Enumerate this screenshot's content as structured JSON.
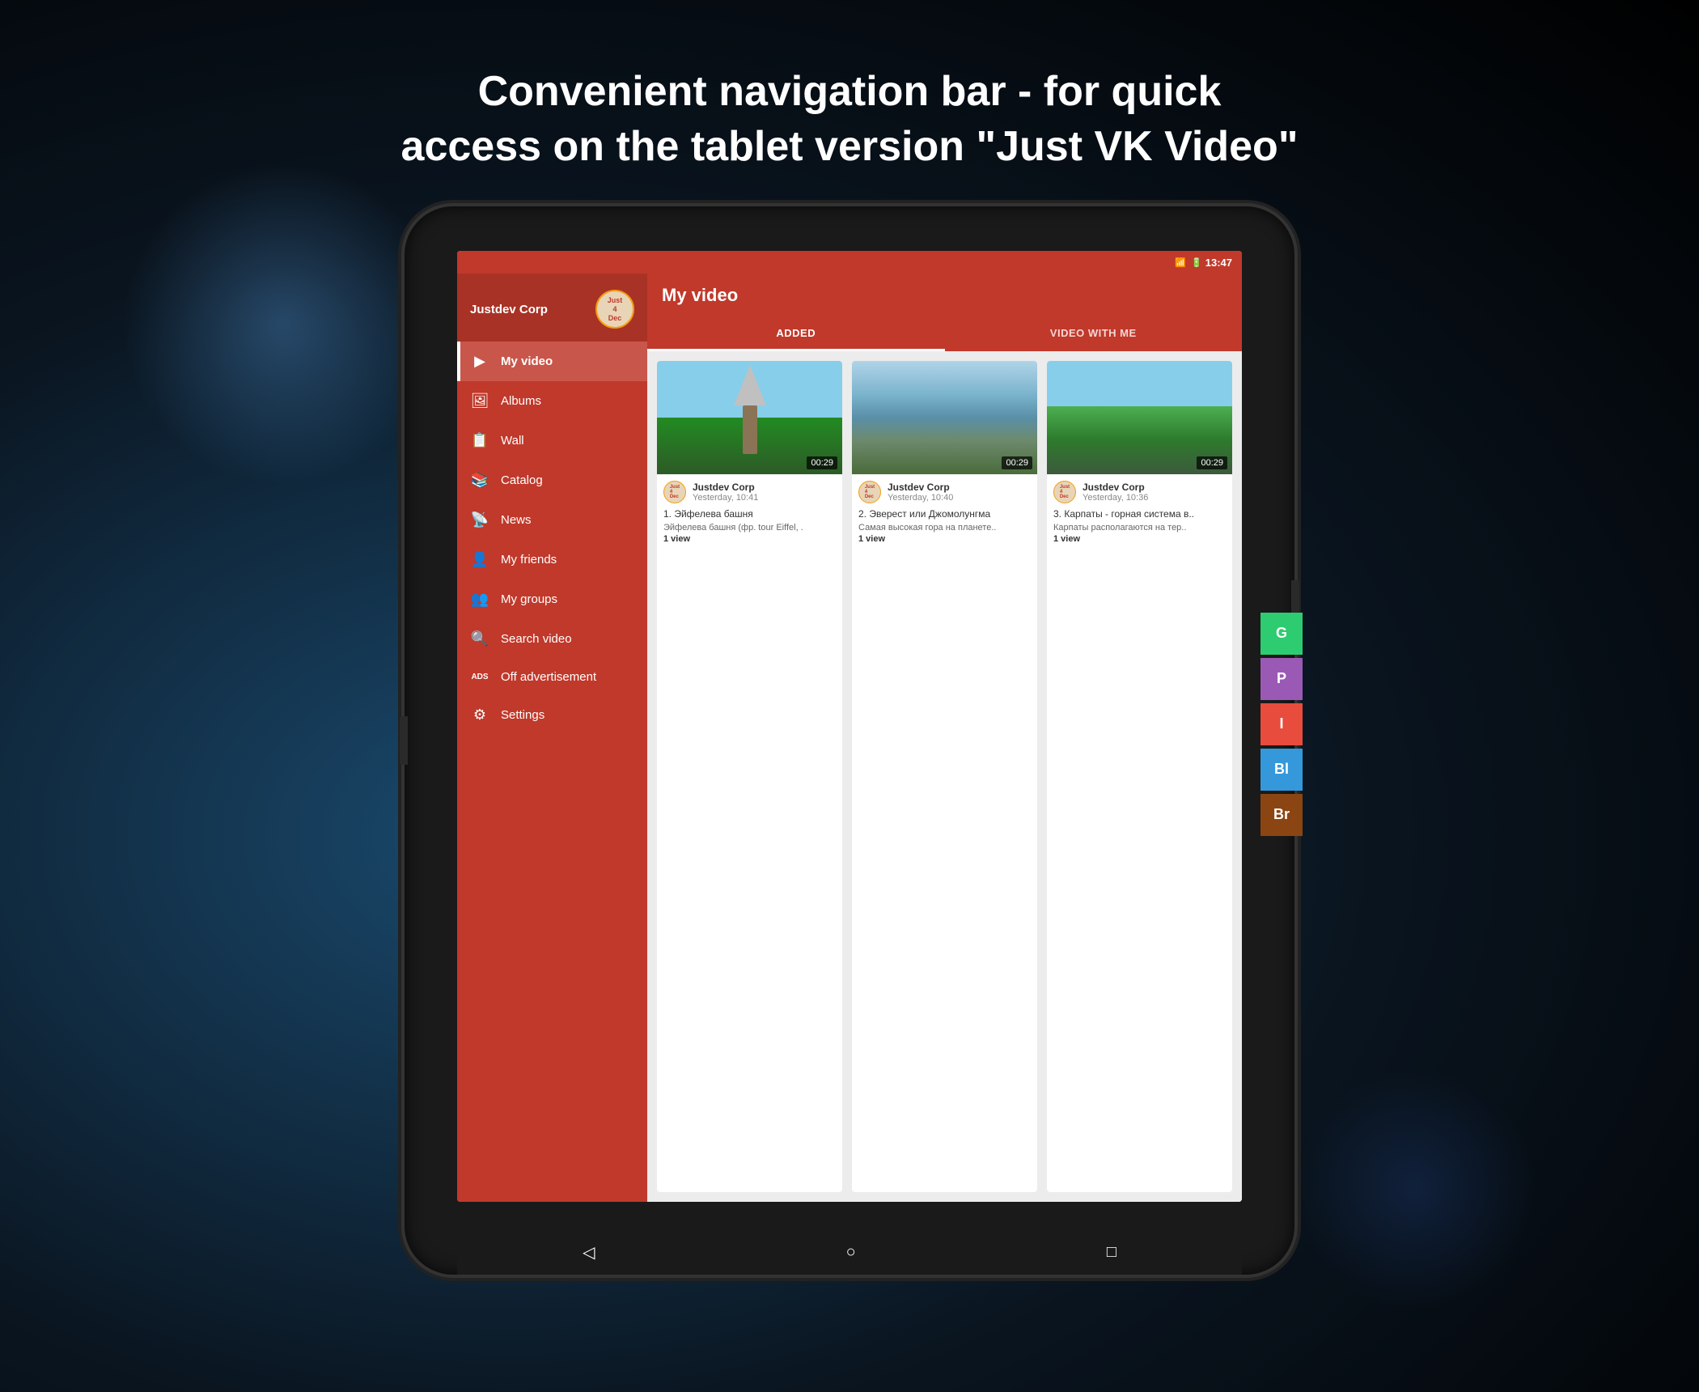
{
  "header": {
    "line1": "Convenient navigation bar - for quick",
    "line2": "access on the tablet version \"Just VK Video\""
  },
  "status_bar": {
    "time": "13:47",
    "icons": [
      "📶",
      "🔋"
    ]
  },
  "user": {
    "name": "Justdev Corp",
    "avatar_line1": "Just",
    "avatar_line2": "4",
    "avatar_line3": "Dec"
  },
  "nav_items": [
    {
      "id": "my-video",
      "label": "My video",
      "icon": "▶",
      "active": true
    },
    {
      "id": "albums",
      "label": "Albums",
      "icon": "🖼",
      "active": false
    },
    {
      "id": "wall",
      "label": "Wall",
      "icon": "📋",
      "active": false
    },
    {
      "id": "catalog",
      "label": "Catalog",
      "icon": "📚",
      "active": false
    },
    {
      "id": "news",
      "label": "News",
      "icon": "📡",
      "active": false
    },
    {
      "id": "my-friends",
      "label": "My friends",
      "icon": "👤",
      "active": false
    },
    {
      "id": "my-groups",
      "label": "My groups",
      "icon": "👥",
      "active": false
    },
    {
      "id": "search-video",
      "label": "Search video",
      "icon": "🔍",
      "active": false
    },
    {
      "id": "off-advertisement",
      "label": "Off advertisement",
      "icon": "ADS",
      "active": false
    },
    {
      "id": "settings",
      "label": "Settings",
      "icon": "⚙",
      "active": false
    }
  ],
  "content": {
    "title": "My video",
    "tabs": [
      {
        "id": "added",
        "label": "ADDED",
        "active": true
      },
      {
        "id": "video-with-me",
        "label": "VIDEO WITH ME",
        "active": false
      }
    ],
    "videos": [
      {
        "id": 1,
        "uploader": "Justdev Corp",
        "date": "Yesterday, 10:41",
        "duration": "00:29",
        "title": "1. Эйфелева башня",
        "subtitle": "Эйфелева башня (фр. tour Eiffel, .",
        "views": "1 view",
        "thumb_class": "thumb-1"
      },
      {
        "id": 2,
        "uploader": "Justdev Corp",
        "date": "Yesterday, 10:40",
        "duration": "00:29",
        "title": "2. Эверест или Джомолунгма",
        "subtitle": "Самая высокая гора на планете..",
        "views": "1 view",
        "thumb_class": "thumb-2"
      },
      {
        "id": 3,
        "uploader": "Justdev Corp",
        "date": "Yesterday, 10:36",
        "duration": "00:29",
        "title": "3. Карпаты - горная система в..",
        "subtitle": "Карпаты располагаются на тер..",
        "views": "1 view",
        "thumb_class": "thumb-3"
      }
    ]
  },
  "bottom_nav": {
    "back": "◁",
    "home": "○",
    "recents": "□"
  },
  "side_buttons": [
    {
      "id": "G",
      "label": "G",
      "color": "side-btn-g"
    },
    {
      "id": "P",
      "label": "P",
      "color": "side-btn-p"
    },
    {
      "id": "I",
      "label": "I",
      "color": "side-btn-i"
    },
    {
      "id": "Bl",
      "label": "Bl",
      "color": "side-btn-bl"
    },
    {
      "id": "Br",
      "label": "Br",
      "color": "side-btn-br"
    }
  ]
}
